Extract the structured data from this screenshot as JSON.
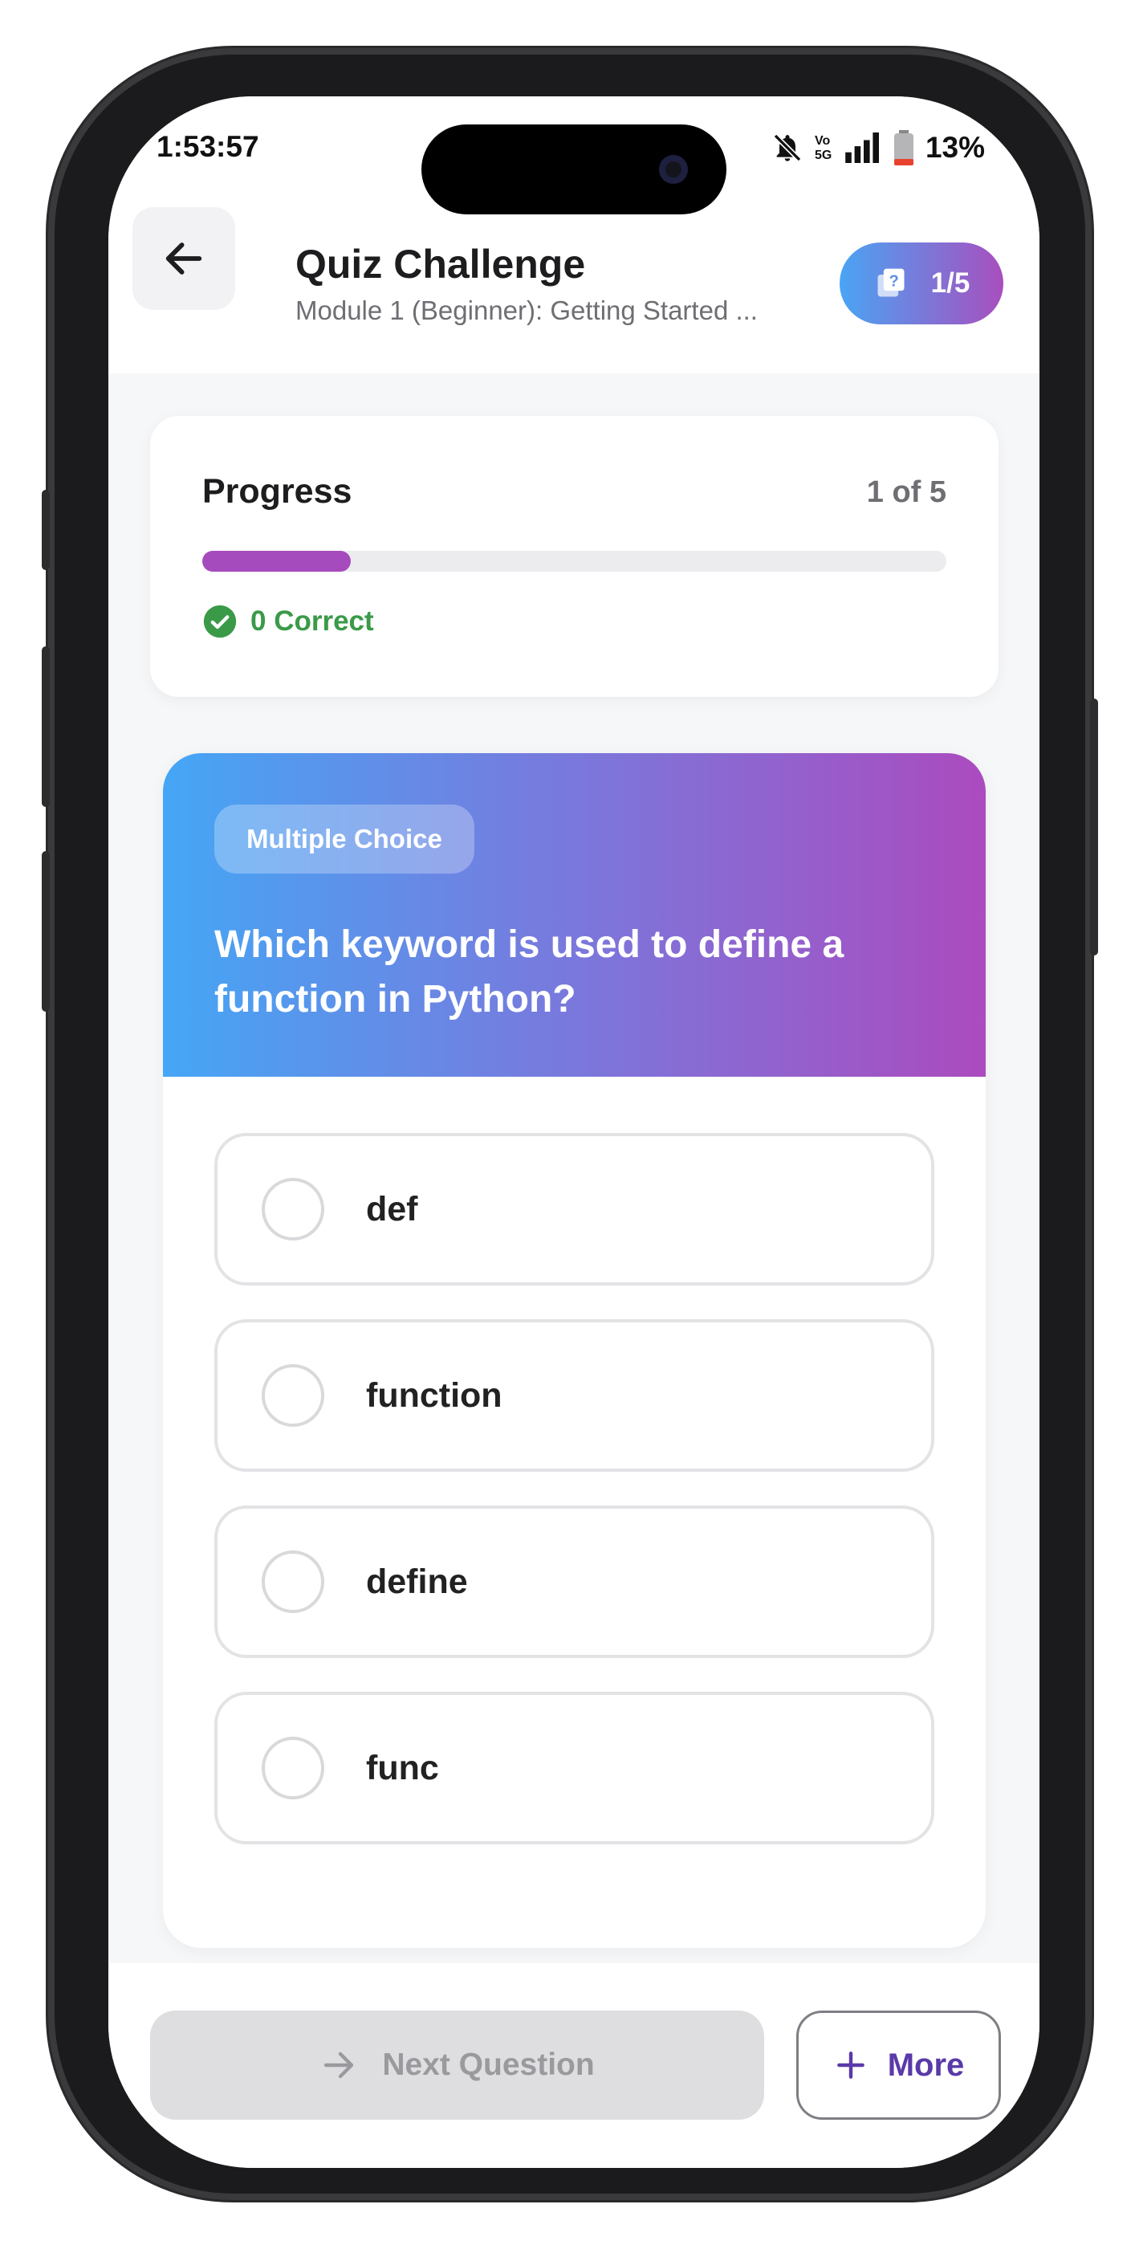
{
  "status": {
    "time": "1:53:57",
    "battery": "13%",
    "icons": [
      "bell-muted-icon",
      "volte-icon",
      "signal-icon",
      "battery-icon"
    ]
  },
  "header": {
    "title": "Quiz Challenge",
    "subtitle": "Module 1 (Beginner): Getting Started ...",
    "counter": "1/5",
    "back_icon": "arrow-left-icon",
    "counter_icon": "quiz-cards-icon"
  },
  "progress": {
    "label": "Progress",
    "count": "1 of 5",
    "fraction": 0.2,
    "correct": "0 Correct",
    "fill_color": "#a64bbd"
  },
  "question": {
    "type": "Multiple Choice",
    "text": "Which keyword is used to define a function in Python?",
    "options": [
      "def",
      "function",
      "define",
      "func"
    ]
  },
  "footer": {
    "next_label": "Next Question",
    "more_label": "More"
  },
  "colors": {
    "gradient_start": "#45a6f5",
    "gradient_end": "#ab4bbf",
    "success": "#3a9a48"
  }
}
